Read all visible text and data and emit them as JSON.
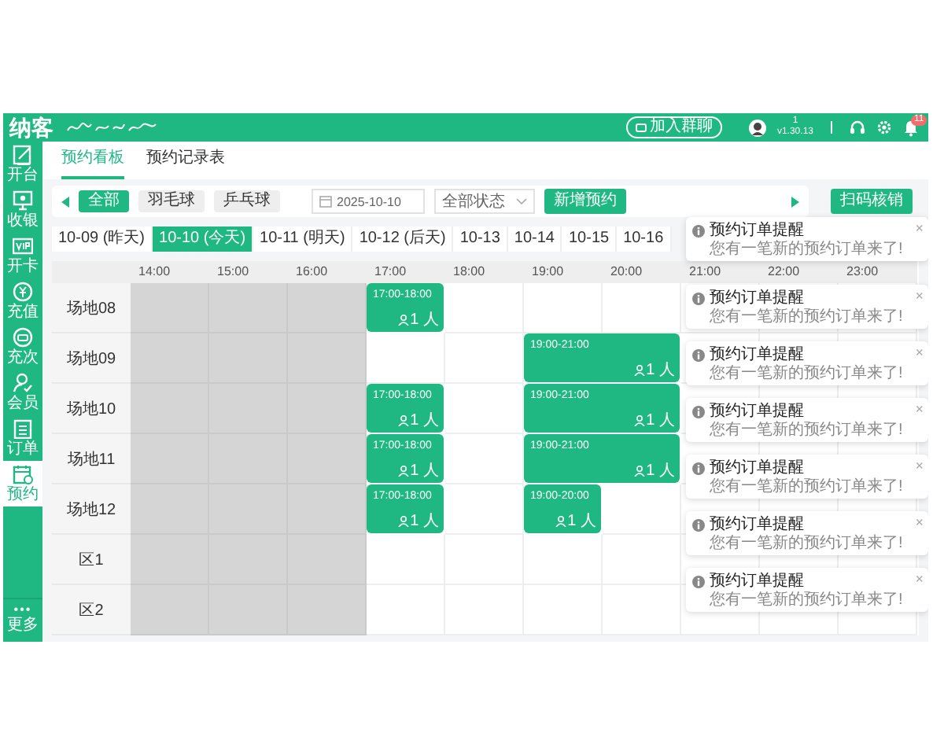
{
  "header": {
    "logo": "纳客",
    "join_button": "加入群聊",
    "user": {
      "name": "1",
      "version": "v1.30.13"
    },
    "notification_count": "11"
  },
  "sidebar": {
    "items": [
      {
        "label": "开台",
        "selected": false
      },
      {
        "label": "收银",
        "selected": false
      },
      {
        "label": "开卡",
        "selected": false
      },
      {
        "label": "充值",
        "selected": false
      },
      {
        "label": "充次",
        "selected": false
      },
      {
        "label": "会员",
        "selected": false
      },
      {
        "label": "订单",
        "selected": false
      },
      {
        "label": "预约",
        "selected": true
      }
    ],
    "more": {
      "icon": "•••",
      "label": "更多"
    }
  },
  "tabs": [
    {
      "label": "预约看板",
      "selected": true
    },
    {
      "label": "预约记录表",
      "selected": false
    }
  ],
  "categories": [
    {
      "label": "全部",
      "selected": true
    },
    {
      "label": "羽毛球",
      "selected": false
    },
    {
      "label": "乒乓球",
      "selected": false
    }
  ],
  "date_field": {
    "value": "2025-10-10"
  },
  "status_select": {
    "value": "全部状态"
  },
  "add_button": "新增预约",
  "scan_button": "扫码核销",
  "dates": [
    {
      "label": "10-09 (昨天)",
      "selected": false
    },
    {
      "label": "10-10 (今天)",
      "selected": true
    },
    {
      "label": "10-11 (明天)",
      "selected": false
    },
    {
      "label": "10-12 (后天)",
      "selected": false
    },
    {
      "label": "10-13",
      "selected": false
    },
    {
      "label": "10-14",
      "selected": false
    },
    {
      "label": "10-15",
      "selected": false
    },
    {
      "label": "10-16",
      "selected": false
    }
  ],
  "schedule": {
    "hours": [
      "14:00",
      "15:00",
      "16:00",
      "17:00",
      "18:00",
      "19:00",
      "20:00",
      "21:00",
      "22:00",
      "23:00"
    ],
    "rows": [
      {
        "name": "场地08",
        "cells": [
          {
            "kind": "past"
          },
          {
            "kind": "past"
          },
          {
            "kind": "past"
          },
          {
            "kind": "booking",
            "time": "17:00-18:00",
            "people": "1 人"
          },
          {
            "kind": "free"
          },
          {
            "kind": "free"
          },
          {
            "kind": "free"
          },
          {
            "kind": "free"
          },
          {
            "kind": "free"
          },
          {
            "kind": "free"
          }
        ]
      },
      {
        "name": "场地09",
        "cells": [
          {
            "kind": "past"
          },
          {
            "kind": "past"
          },
          {
            "kind": "past"
          },
          {
            "kind": "free"
          },
          {
            "kind": "free"
          },
          {
            "kind": "booking",
            "time": "19:00-21:00",
            "people": "1 人"
          },
          {
            "kind": "booked"
          },
          {
            "kind": "free"
          },
          {
            "kind": "free"
          },
          {
            "kind": "free"
          }
        ]
      },
      {
        "name": "场地10",
        "cells": [
          {
            "kind": "past"
          },
          {
            "kind": "past"
          },
          {
            "kind": "past"
          },
          {
            "kind": "booking",
            "time": "17:00-18:00",
            "people": "1 人"
          },
          {
            "kind": "free"
          },
          {
            "kind": "booking",
            "time": "19:00-21:00",
            "people": "1 人"
          },
          {
            "kind": "booked"
          },
          {
            "kind": "free"
          },
          {
            "kind": "free"
          },
          {
            "kind": "free"
          }
        ]
      },
      {
        "name": "场地11",
        "cells": [
          {
            "kind": "past"
          },
          {
            "kind": "past"
          },
          {
            "kind": "past"
          },
          {
            "kind": "booking",
            "time": "17:00-18:00",
            "people": "1 人"
          },
          {
            "kind": "free"
          },
          {
            "kind": "booking",
            "time": "19:00-21:00",
            "people": "1 人"
          },
          {
            "kind": "booked"
          },
          {
            "kind": "free"
          },
          {
            "kind": "free"
          },
          {
            "kind": "free"
          }
        ]
      },
      {
        "name": "场地12",
        "cells": [
          {
            "kind": "past"
          },
          {
            "kind": "past"
          },
          {
            "kind": "past"
          },
          {
            "kind": "booking",
            "time": "17:00-18:00",
            "people": "1 人"
          },
          {
            "kind": "free"
          },
          {
            "kind": "booking",
            "time": "19:00-20:00",
            "people": "1 人"
          },
          {
            "kind": "free"
          },
          {
            "kind": "free"
          },
          {
            "kind": "free"
          },
          {
            "kind": "free"
          }
        ]
      },
      {
        "name": "区1",
        "cells": [
          {
            "kind": "past"
          },
          {
            "kind": "past"
          },
          {
            "kind": "past"
          },
          {
            "kind": "free"
          },
          {
            "kind": "free"
          },
          {
            "kind": "free"
          },
          {
            "kind": "free"
          },
          {
            "kind": "free"
          },
          {
            "kind": "free"
          },
          {
            "kind": "free"
          }
        ]
      },
      {
        "name": "区2",
        "cells": [
          {
            "kind": "past"
          },
          {
            "kind": "past"
          },
          {
            "kind": "past"
          },
          {
            "kind": "free"
          },
          {
            "kind": "free"
          },
          {
            "kind": "free"
          },
          {
            "kind": "free"
          },
          {
            "kind": "free"
          },
          {
            "kind": "free"
          },
          {
            "kind": "free"
          }
        ]
      }
    ]
  },
  "notifications": [
    {
      "title": "预约订单提醒",
      "body": "您有一笔新的预约订单来了!",
      "close": "×"
    },
    {
      "title": "预约订单提醒",
      "body": "您有一笔新的预约订单来了!",
      "close": "×"
    },
    {
      "title": "预约订单提醒",
      "body": "您有一笔新的预约订单来了!",
      "close": "×"
    },
    {
      "title": "预约订单提醒",
      "body": "您有一笔新的预约订单来了!",
      "close": "×"
    },
    {
      "title": "预约订单提醒",
      "body": "您有一笔新的预约订单来了!",
      "close": "×"
    },
    {
      "title": "预约订单提醒",
      "body": "您有一笔新的预约订单来了!",
      "close": "×"
    },
    {
      "title": "预约订单提醒",
      "body": "您有一笔新的预约订单来了!",
      "close": "×"
    }
  ]
}
